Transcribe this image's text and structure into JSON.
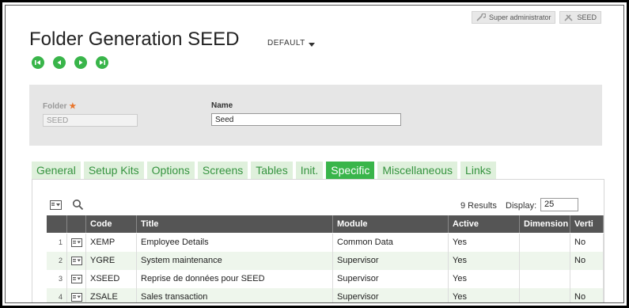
{
  "user": {
    "role": "Super administrator",
    "folder": "SEED"
  },
  "page": {
    "title": "Folder Generation SEED",
    "variant": "DEFAULT"
  },
  "nav": [
    "first-record-icon",
    "previous-record-icon",
    "next-record-icon",
    "last-record-icon"
  ],
  "form": {
    "folder_label": "Folder",
    "folder_required": "★",
    "folder_value": "SEED",
    "name_label": "Name",
    "name_value": "Seed"
  },
  "tabs": [
    "General",
    "Setup Kits",
    "Options",
    "Screens",
    "Tables",
    "Init.",
    "Specific",
    "Miscellaneous",
    "Links"
  ],
  "active_tab": "Specific",
  "grid": {
    "results": "9 Results",
    "display_label": "Display:",
    "display_value": "25",
    "columns": [
      "Code",
      "Title",
      "Module",
      "Active",
      "Dimension",
      "Verti"
    ],
    "rows": [
      {
        "n": "1",
        "code": "XEMP",
        "title": "Employee Details",
        "module": "Common Data",
        "active": "Yes",
        "dimension": "",
        "verti": "No"
      },
      {
        "n": "2",
        "code": "YGRE",
        "title": "System maintenance",
        "module": "Supervisor",
        "active": "Yes",
        "dimension": "",
        "verti": "No"
      },
      {
        "n": "3",
        "code": "XSEED",
        "title": "Reprise de données pour SEED",
        "module": "Supervisor",
        "active": "Yes",
        "dimension": "",
        "verti": ""
      },
      {
        "n": "4",
        "code": "ZSALE",
        "title": "Sales transaction",
        "module": "Supervisor",
        "active": "Yes",
        "dimension": "",
        "verti": "No"
      }
    ]
  },
  "colors": {
    "accent": "#39b54a",
    "tab_bg": "#dff0dc",
    "tab_text": "#35933f",
    "header_bg": "#555555",
    "alt_row": "#eef6ec"
  }
}
